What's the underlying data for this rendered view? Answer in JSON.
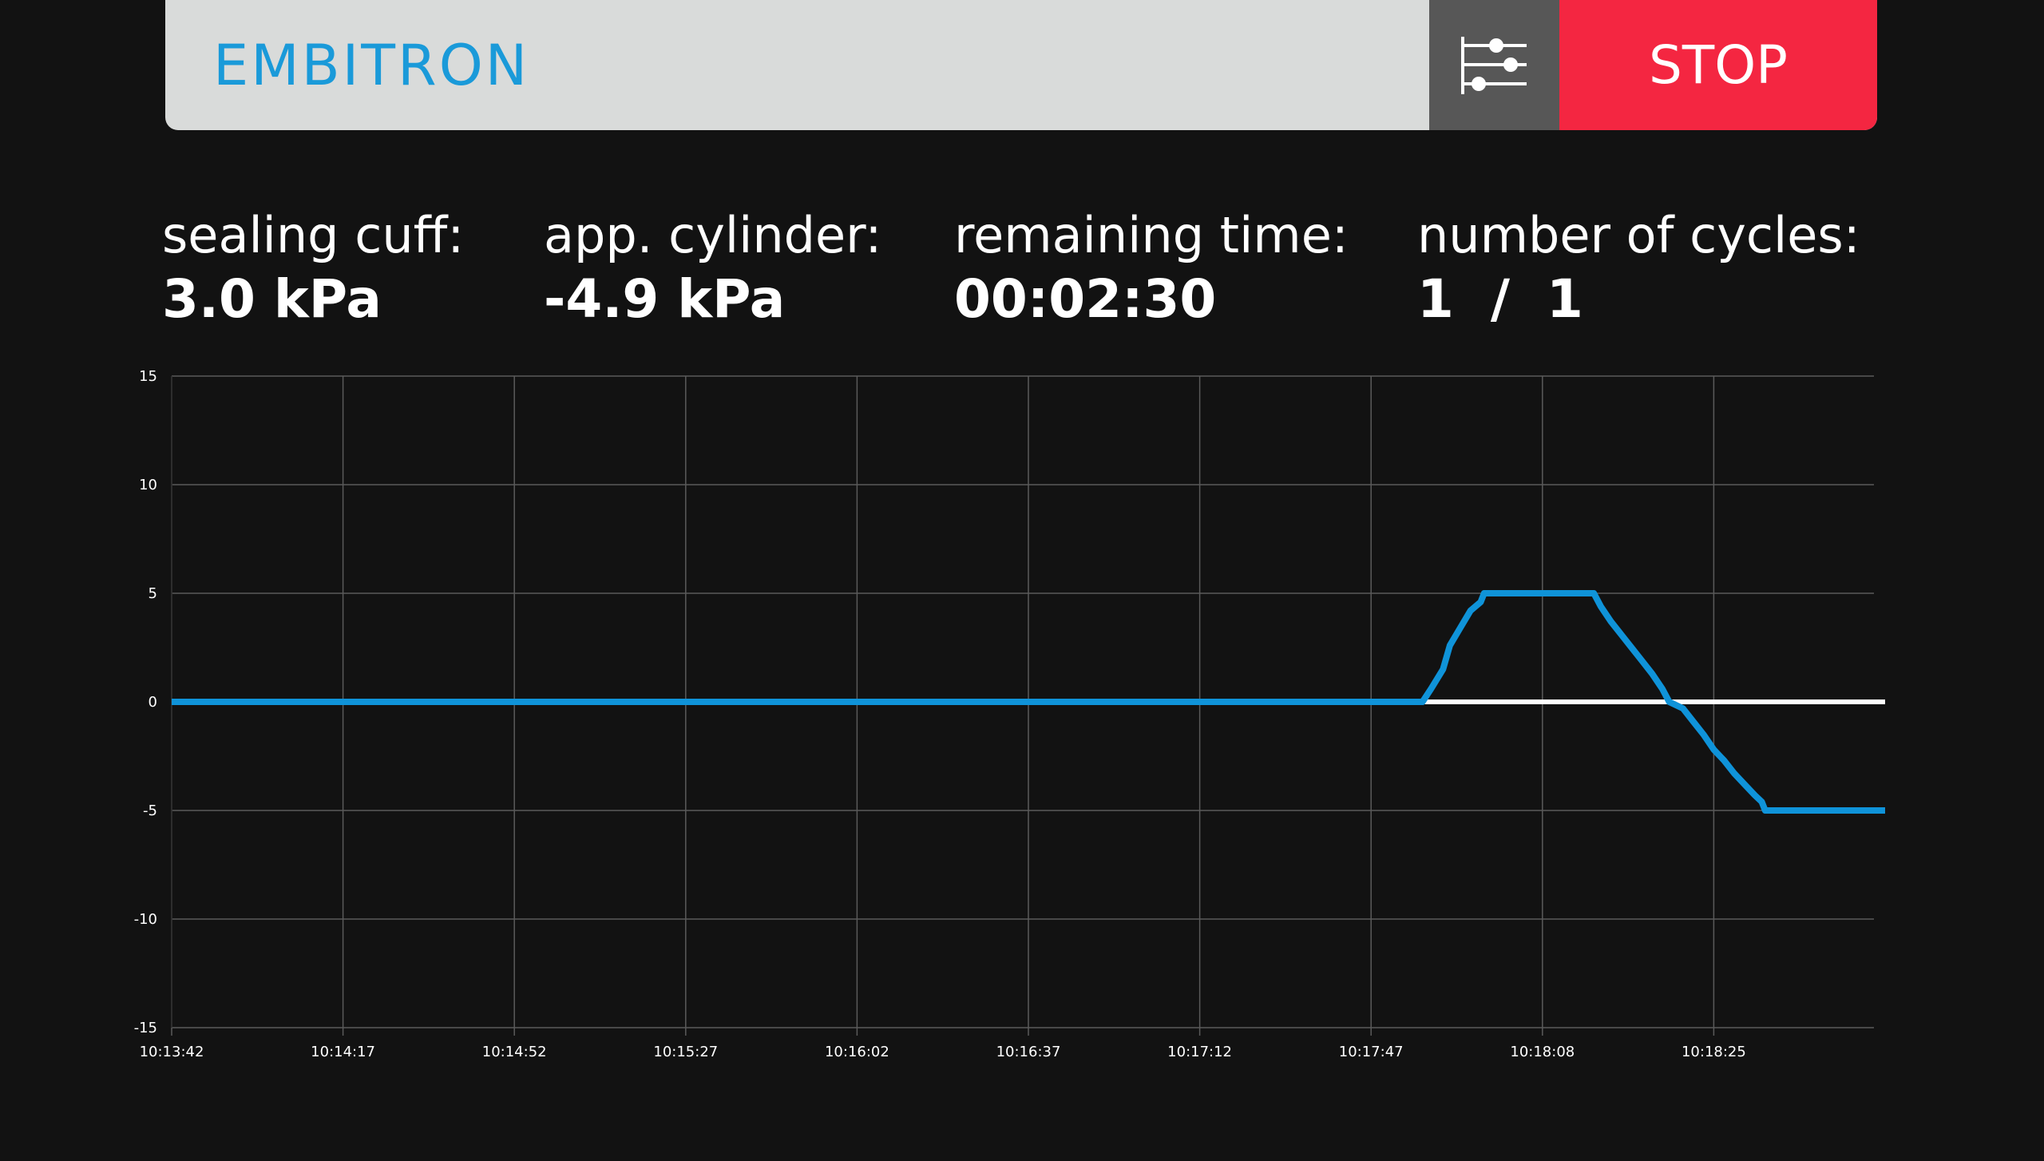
{
  "header": {
    "brand": "EMBITRON",
    "settings_icon": "sliders-icon",
    "stop_label": "STOP"
  },
  "stats": {
    "sealing_cuff": {
      "label": "sealing cuff:",
      "value": "3.0 kPa"
    },
    "app_cylinder": {
      "label": "app. cylinder:",
      "value": "-4.9 kPa"
    },
    "remaining_time": {
      "label": "remaining time:",
      "value": "00:02:30"
    },
    "cycles": {
      "label": "number of cycles:",
      "value": "1  /  1"
    }
  },
  "colors": {
    "background": "#121212",
    "header": "#d9dbda",
    "brand": "#1a9ad9",
    "stop": "#f42641",
    "settings": "#575757",
    "series_blue": "#0f93d9",
    "series_white": "#ffffff",
    "grid": "#5a5a5a"
  },
  "chart_data": {
    "type": "line",
    "x_ticks": [
      "10:13:42",
      "10:14:17",
      "10:14:52",
      "10:15:27",
      "10:16:02",
      "10:16:37",
      "10:17:12",
      "10:17:47",
      "10:18:08",
      "10:18:25"
    ],
    "y_ticks": [
      "15",
      "10",
      "5",
      "0",
      "-5",
      "-10",
      "-15"
    ],
    "ylim": [
      -15,
      15
    ],
    "xlim": [
      0,
      10
    ],
    "grid": true,
    "series": [
      {
        "color": "#ffffff",
        "points": [
          [
            7.27,
            0
          ],
          [
            10,
            0
          ]
        ]
      },
      {
        "color": "#0f93d9",
        "points": [
          [
            0,
            0
          ],
          [
            7.27,
            0
          ],
          [
            7.3,
            0
          ],
          [
            7.35,
            0.6
          ],
          [
            7.42,
            1.5
          ],
          [
            7.46,
            2.6
          ],
          [
            7.52,
            3.4
          ],
          [
            7.58,
            4.2
          ],
          [
            7.64,
            4.6
          ],
          [
            7.66,
            5
          ],
          [
            8.3,
            5
          ],
          [
            8.34,
            4.4
          ],
          [
            8.4,
            3.7
          ],
          [
            8.46,
            3.1
          ],
          [
            8.52,
            2.5
          ],
          [
            8.58,
            1.9
          ],
          [
            8.64,
            1.3
          ],
          [
            8.7,
            0.6
          ],
          [
            8.74,
            0
          ],
          [
            8.82,
            -0.3
          ],
          [
            8.88,
            -0.9
          ],
          [
            8.94,
            -1.5
          ],
          [
            9.0,
            -2.2
          ],
          [
            9.06,
            -2.7
          ],
          [
            9.12,
            -3.3
          ],
          [
            9.18,
            -3.8
          ],
          [
            9.24,
            -4.3
          ],
          [
            9.28,
            -4.6
          ],
          [
            9.3,
            -5
          ],
          [
            10,
            -5
          ]
        ]
      }
    ]
  }
}
